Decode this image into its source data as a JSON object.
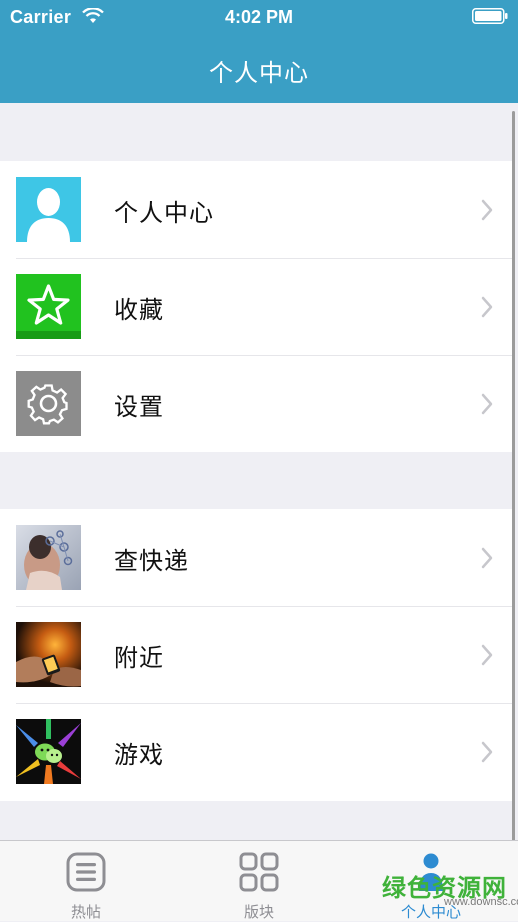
{
  "status_bar": {
    "carrier": "Carrier",
    "time": "4:02 PM"
  },
  "nav": {
    "title": "个人中心"
  },
  "groups": [
    {
      "items": [
        {
          "label": "个人中心",
          "icon": "user-silhouette-icon",
          "color": "#3ec6e6"
        },
        {
          "label": "收藏",
          "icon": "star-icon",
          "color": "#21c21f"
        },
        {
          "label": "设置",
          "icon": "gear-icon",
          "color": "#8c8c8c"
        }
      ]
    },
    {
      "items": [
        {
          "label": "查快递",
          "icon": "network-people-photo"
        },
        {
          "label": "附近",
          "icon": "hands-phone-photo"
        },
        {
          "label": "游戏",
          "icon": "colorful-hands-photo"
        }
      ]
    }
  ],
  "tabbar": {
    "tabs": [
      {
        "label": "热帖",
        "icon": "list-icon",
        "active": false
      },
      {
        "label": "版块",
        "icon": "grid-icon",
        "active": false
      },
      {
        "label": "个人中心",
        "icon": "person-icon",
        "active": true
      }
    ]
  },
  "watermark": {
    "text": "绿色资源网",
    "url": "www.downsc.com"
  },
  "colors": {
    "accent": "#3a9fc5",
    "tab_active": "#2d8bd1",
    "background": "#efeff4"
  }
}
